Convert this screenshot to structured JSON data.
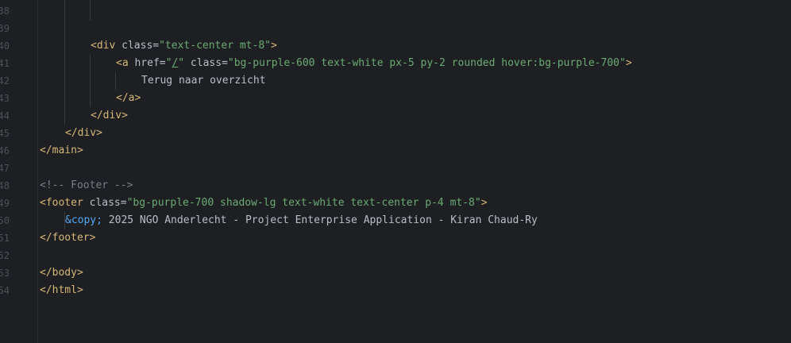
{
  "editor": {
    "line_numbers": [
      "38",
      "39",
      "40",
      "41",
      "42",
      "43",
      "44",
      "45",
      "46",
      "47",
      "48",
      "49",
      "50",
      "51",
      "52",
      "53",
      "54"
    ],
    "lines": {
      "l40": {
        "open": "<div",
        "attr": " class=",
        "val": "\"text-center mt-8\"",
        "close": ">"
      },
      "l41": {
        "open": "<a",
        "attr1": " href=",
        "val1_q1": "\"",
        "val1_slash": "/",
        "val1_q2": "\"",
        "attr2": " class=",
        "val2": "\"bg-purple-600 text-white px-5 py-2 rounded hover:bg-purple-700\"",
        "close": ">"
      },
      "l42": {
        "text": "Terug naar overzicht"
      },
      "l43": {
        "tag": "</a>"
      },
      "l44": {
        "tag": "</div>"
      },
      "l45": {
        "tag": "</div>"
      },
      "l46": {
        "tag": "</main>"
      },
      "l48": {
        "comment": "<!-- Footer -->"
      },
      "l49": {
        "open": "<footer",
        "attr": " class=",
        "val": "\"bg-purple-700 shadow-lg text-white text-center p-4 mt-8\"",
        "close": ">"
      },
      "l50": {
        "entity": "&copy;",
        "text": " 2025 NGO Anderlecht - Project Enterprise Application - Kiran Chaud-Ry"
      },
      "l51": {
        "tag": "</footer>"
      },
      "l53": {
        "tag": "</body>"
      },
      "l54": {
        "tag": "</html>"
      }
    }
  }
}
